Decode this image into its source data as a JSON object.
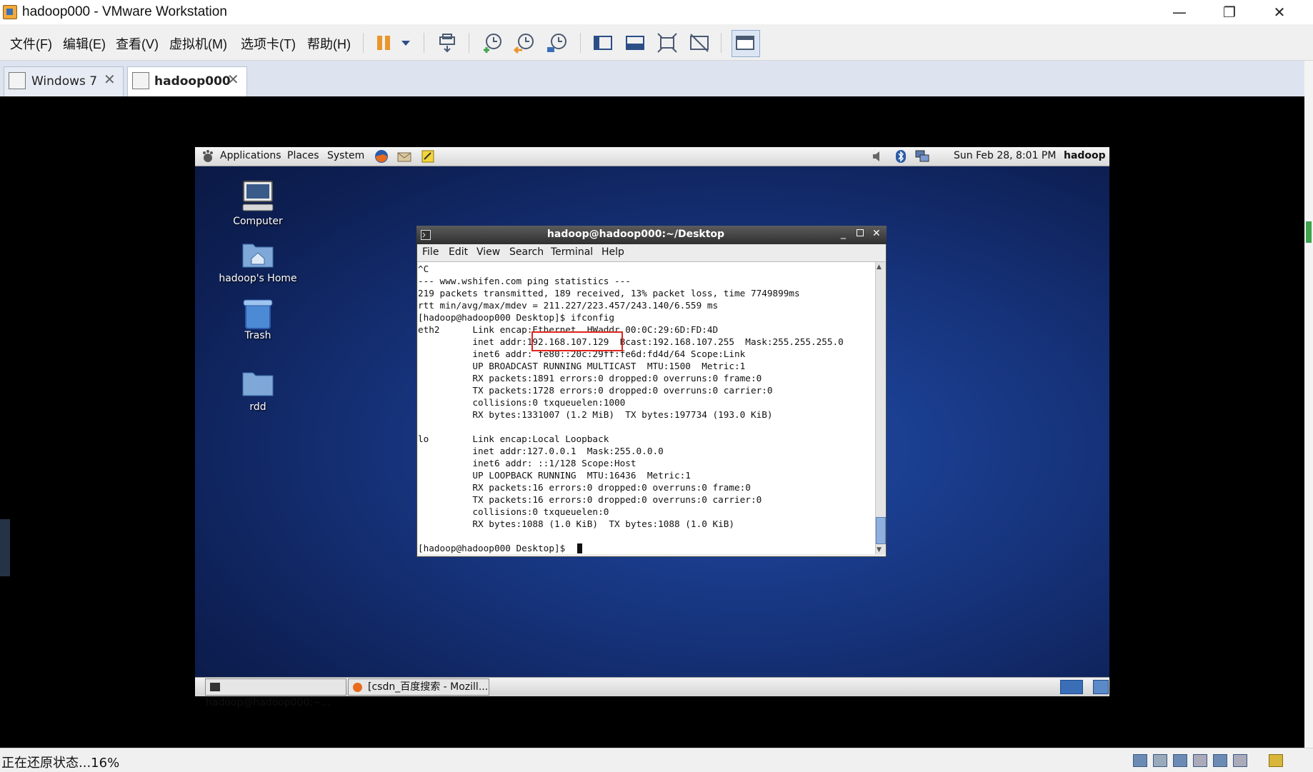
{
  "window": {
    "title": "hadoop000 - VMware Workstation",
    "controls": {
      "minimize": "—",
      "restore": "❐",
      "close": "✕"
    }
  },
  "menu": [
    "文件(F)",
    "编辑(E)",
    "查看(V)",
    "虚拟机(M)",
    "选项卡(T)",
    "帮助(H)"
  ],
  "toolbar": {
    "icons": [
      "pause-icon",
      "dropdown-icon",
      "send-keys-icon",
      "snapshot-take-icon",
      "snapshot-revert-icon",
      "snapshot-manager-icon",
      "console-view-icon",
      "thumbnail-view-icon",
      "fullscreen-icon",
      "unity-icon",
      "library-icon"
    ]
  },
  "tabs": [
    {
      "label": "Windows 7",
      "active": false
    },
    {
      "label": "hadoop000",
      "active": true
    }
  ],
  "guest": {
    "panel": {
      "menus": [
        "Applications",
        "Places",
        "System"
      ],
      "clock": "Sun Feb 28,  8:01 PM",
      "user": "hadoop"
    },
    "desktop_icons": [
      "Computer",
      "hadoop's Home",
      "Trash",
      "rdd"
    ],
    "terminal": {
      "title": "hadoop@hadoop000:~/Desktop",
      "menus": [
        "File",
        "Edit",
        "View",
        "Search",
        "Terminal",
        "Help"
      ],
      "lines": [
        "^C",
        "--- www.wshifen.com ping statistics ---",
        "219 packets transmitted, 189 received, 13% packet loss, time 7749899ms",
        "rtt min/avg/max/mdev = 211.227/223.457/243.140/6.559 ms",
        "[hadoop@hadoop000 Desktop]$ ifconfig",
        "eth2      Link encap:Ethernet  HWaddr 00:0C:29:6D:FD:4D  ",
        "          inet addr:192.168.107.129  Bcast:192.168.107.255  Mask:255.255.255.0",
        "          inet6 addr: fe80::20c:29ff:fe6d:fd4d/64 Scope:Link",
        "          UP BROADCAST RUNNING MULTICAST  MTU:1500  Metric:1",
        "          RX packets:1891 errors:0 dropped:0 overruns:0 frame:0",
        "          TX packets:1728 errors:0 dropped:0 overruns:0 carrier:0",
        "          collisions:0 txqueuelen:1000 ",
        "          RX bytes:1331007 (1.2 MiB)  TX bytes:197734 (193.0 KiB)",
        "",
        "lo        Link encap:Local Loopback  ",
        "          inet addr:127.0.0.1  Mask:255.0.0.0",
        "          inet6 addr: ::1/128 Scope:Host",
        "          UP LOOPBACK RUNNING  MTU:16436  Metric:1",
        "          RX packets:16 errors:0 dropped:0 overruns:0 frame:0",
        "          TX packets:16 errors:0 dropped:0 overruns:0 carrier:0",
        "          collisions:0 txqueuelen:0 ",
        "          RX bytes:1088 (1.0 KiB)  TX bytes:1088 (1.0 KiB)",
        "",
        "[hadoop@hadoop000 Desktop]$ "
      ],
      "highlight_value": "192.168.107.129"
    },
    "taskbar": [
      "hadoop@hadoop000:~...",
      "[csdn_百度搜索 - Mozill..."
    ]
  },
  "status": {
    "text": "正在还原状态...16%",
    "progress_percent": 16
  },
  "colors": {
    "highlight_box": "#e0241c",
    "desktop_blue": "#17357f",
    "terminal_title": "#3a3a3a"
  }
}
